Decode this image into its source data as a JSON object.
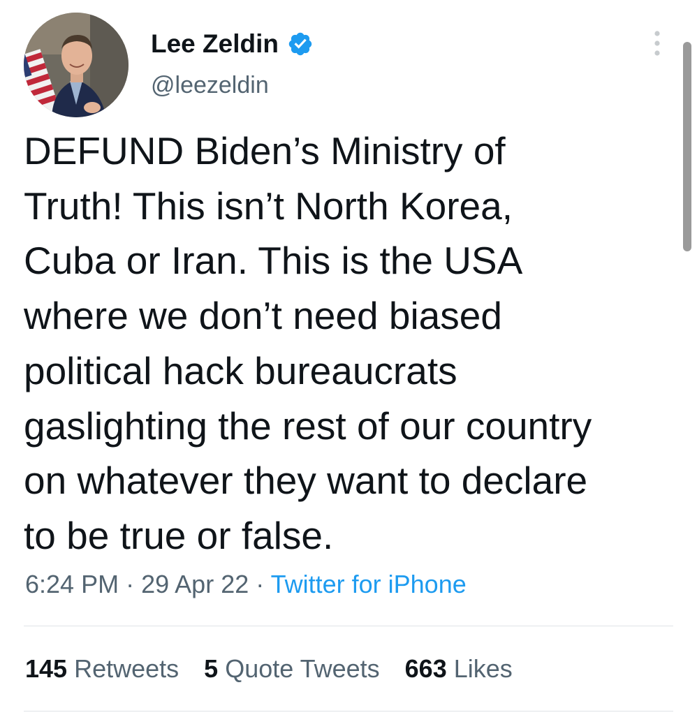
{
  "author": {
    "display_name": "Lee Zeldin",
    "handle": "@leezeldin",
    "verified_icon": "verified-badge-icon",
    "avatar_icon": "profile-photo"
  },
  "tweet": {
    "text_lines": [
      "DEFUND Biden’s Ministry of",
      "Truth! This isn’t North Korea,",
      "Cuba or Iran. This is the USA",
      "where we don’t need biased",
      "political hack bureaucrats",
      "gaslighting the rest of our country",
      "on whatever they want to declare",
      "to be true or false."
    ],
    "time": "6:24 PM",
    "date": "29 Apr 22",
    "separator": "·",
    "source": "Twitter for iPhone"
  },
  "stats": {
    "retweets": {
      "count": "145",
      "label": "Retweets"
    },
    "quote_tweets": {
      "count": "5",
      "label": "Quote Tweets"
    },
    "likes": {
      "count": "663",
      "label": "Likes"
    }
  },
  "colors": {
    "text_primary": "#0f1419",
    "text_secondary": "#536471",
    "accent": "#1d9bf0",
    "divider": "#dfe3e6"
  }
}
